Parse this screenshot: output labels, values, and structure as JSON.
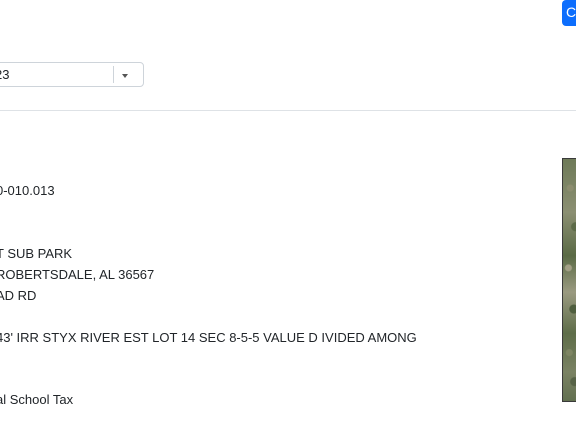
{
  "header": {
    "button_label": "C"
  },
  "filter": {
    "selected_value": "23"
  },
  "parcel": {
    "parcel_number": "0-010.013",
    "subdivision": "T SUB PARK",
    "city_state_zip": "ROBERTSDALE, AL 36567",
    "road": "AD RD",
    "legal_description": "43' IRR STYX RIVER EST LOT 14 SEC 8-5-5 VALUE D IVIDED AMONG",
    "tax_district": "al School Tax"
  },
  "icons": {
    "select_caret": "chevron-down-icon"
  }
}
